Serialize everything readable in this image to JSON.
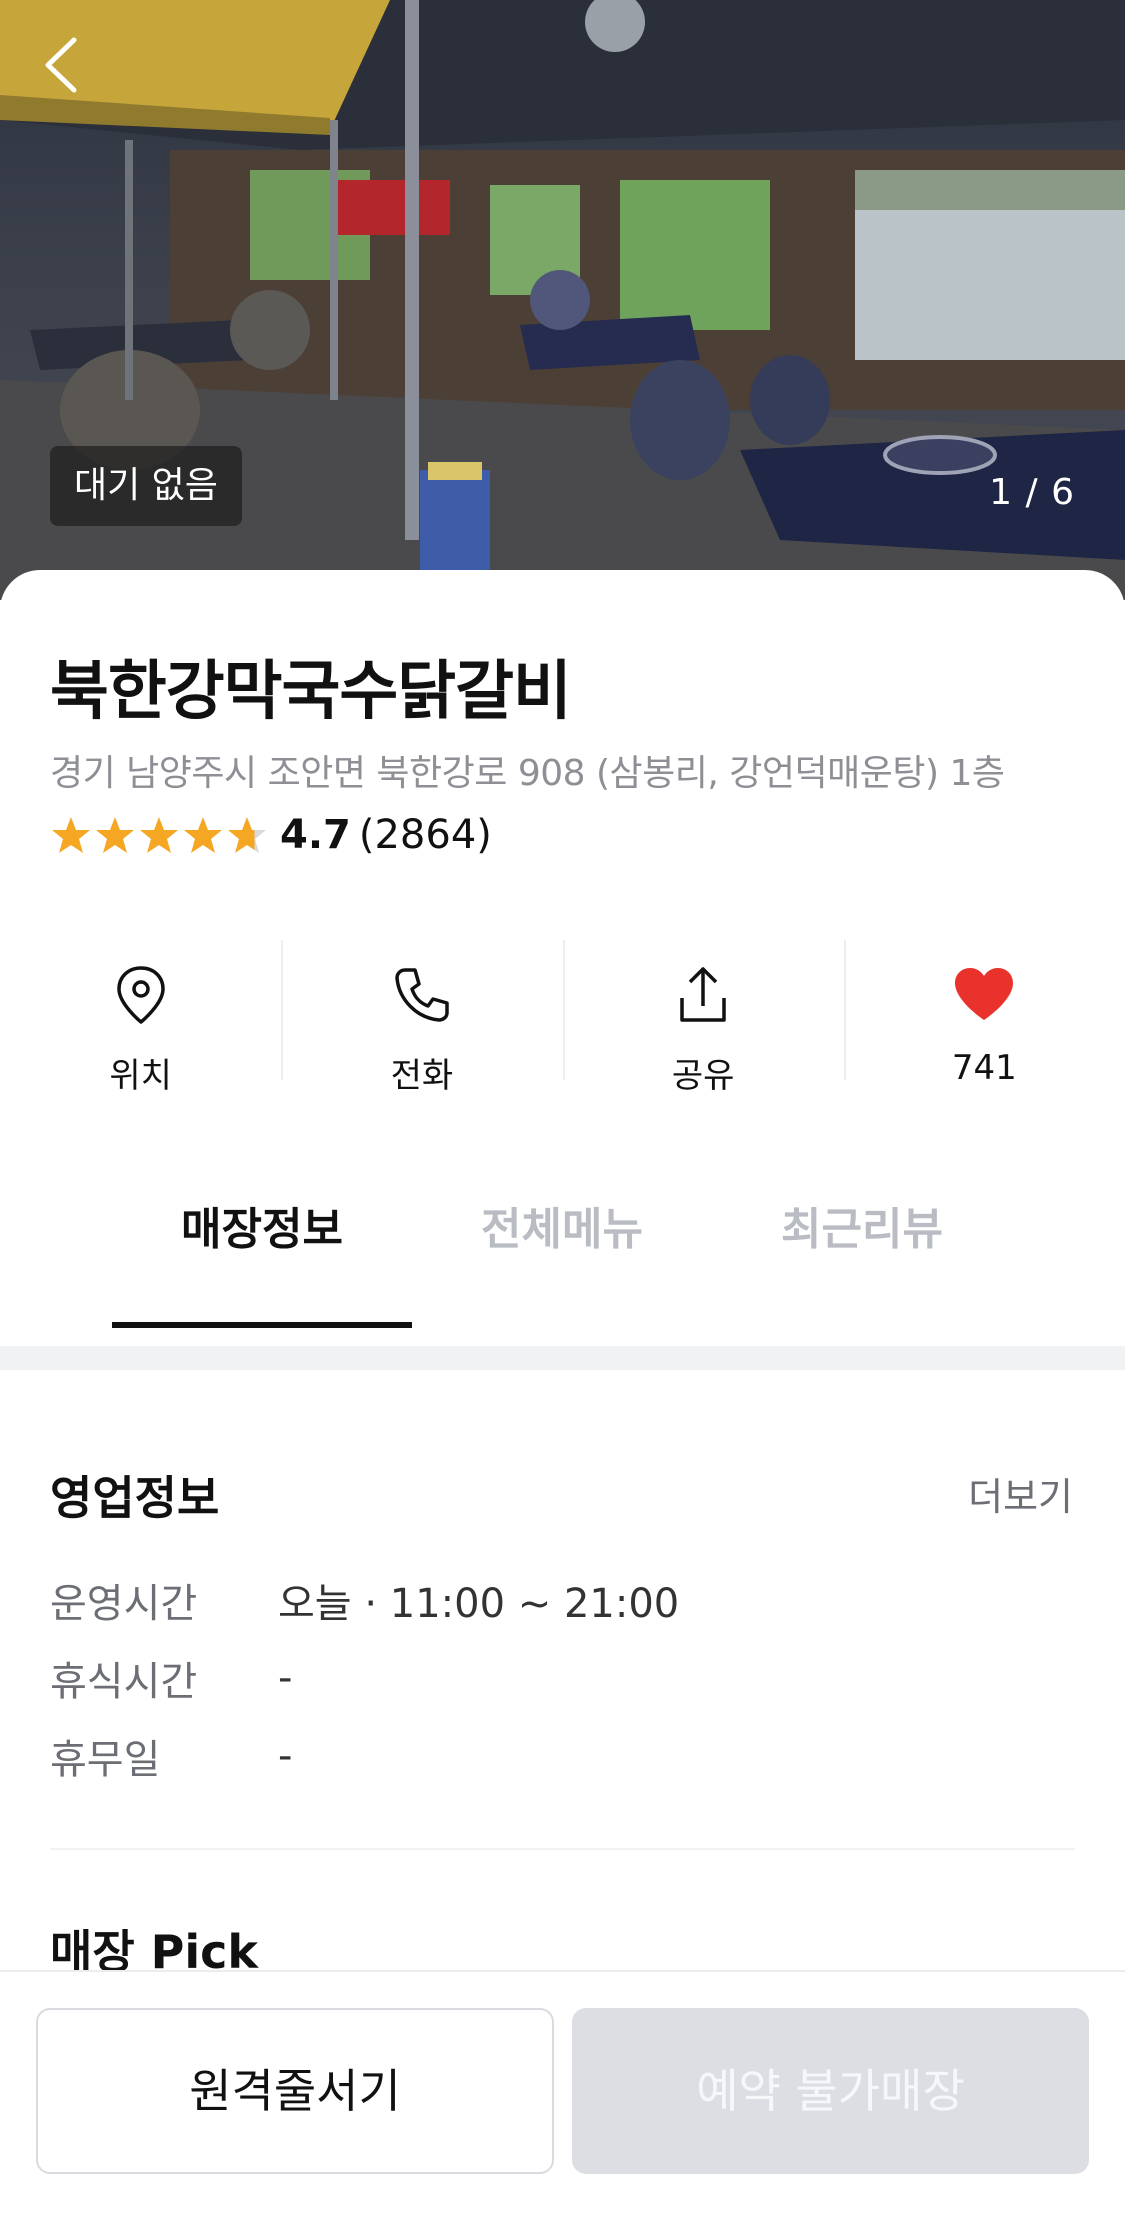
{
  "hero": {
    "wait_badge": "대기 없음",
    "photo_counter": "1 / 6"
  },
  "store": {
    "name": "북한강막국수닭갈비",
    "address": "경기 남양주시 조안면 북한강로 908 (삼봉리, 강언덕매운탕) 1층",
    "rating": "4.7",
    "rating_stars": 4.7,
    "review_count": "(2864)"
  },
  "actions": [
    {
      "label": "위치",
      "icon": "location-pin-icon"
    },
    {
      "label": "전화",
      "icon": "phone-icon"
    },
    {
      "label": "공유",
      "icon": "share-icon"
    },
    {
      "label": "741",
      "icon": "heart-icon"
    }
  ],
  "tabs": [
    {
      "label": "매장정보",
      "active": true
    },
    {
      "label": "전체메뉴",
      "active": false
    },
    {
      "label": "최근리뷰",
      "active": false
    }
  ],
  "business_info": {
    "title": "영업정보",
    "more": "더보기",
    "rows": [
      {
        "key": "운영시간",
        "value": "오늘 · 11:00 ~ 21:00"
      },
      {
        "key": "휴식시간",
        "value": "-"
      },
      {
        "key": "휴무일",
        "value": "-"
      }
    ]
  },
  "store_pick": {
    "title": "매장 Pick"
  },
  "bottom": {
    "queue_button": "원격줄서기",
    "reserve_button": "예약 불가매장"
  },
  "colors": {
    "star": "#f5a623",
    "heart": "#e8322b",
    "accent_text": "#111111",
    "muted_text": "#8d8f95"
  }
}
